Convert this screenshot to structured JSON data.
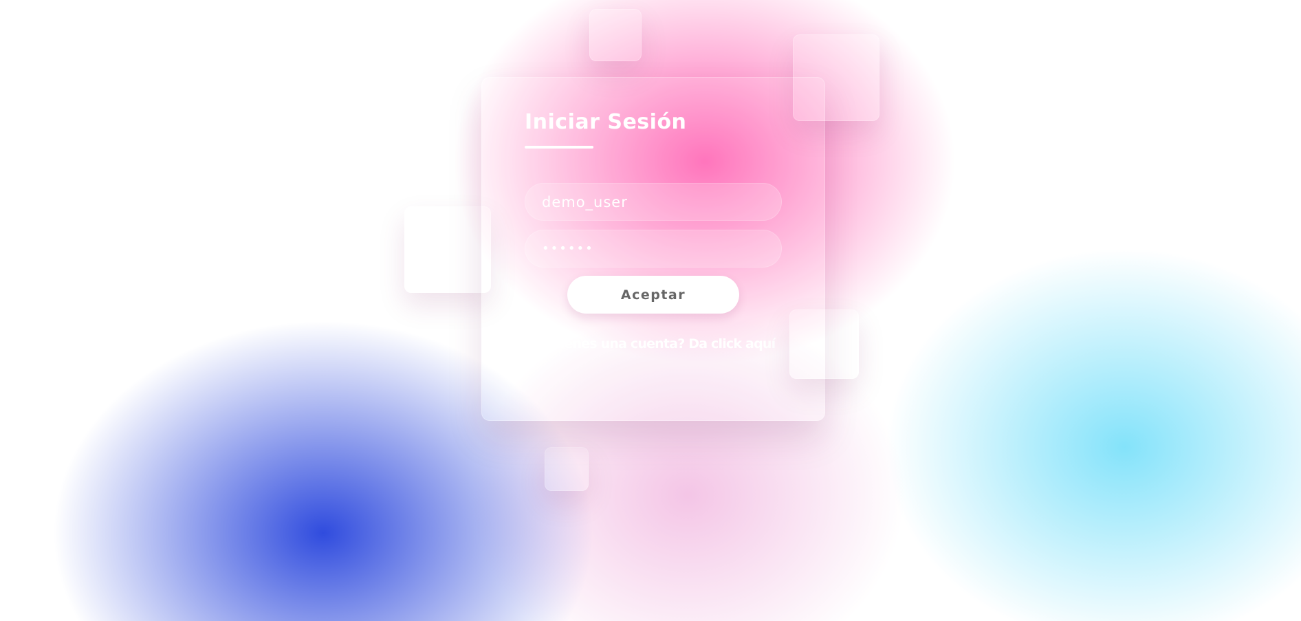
{
  "login": {
    "title": "Iniciar Sesión",
    "username_value": "demo_user",
    "password_value": "••••••",
    "accept_label": "Aceptar",
    "signup_link": "¿No tienes una cuenta? Da click aquí"
  },
  "colors": {
    "pink_glow": "#ff5aaf",
    "blue_glow": "#304cde",
    "cyan_glow": "#7de1fa",
    "button_bg": "#ffffff",
    "button_text": "#666666",
    "text": "#ffffff"
  }
}
